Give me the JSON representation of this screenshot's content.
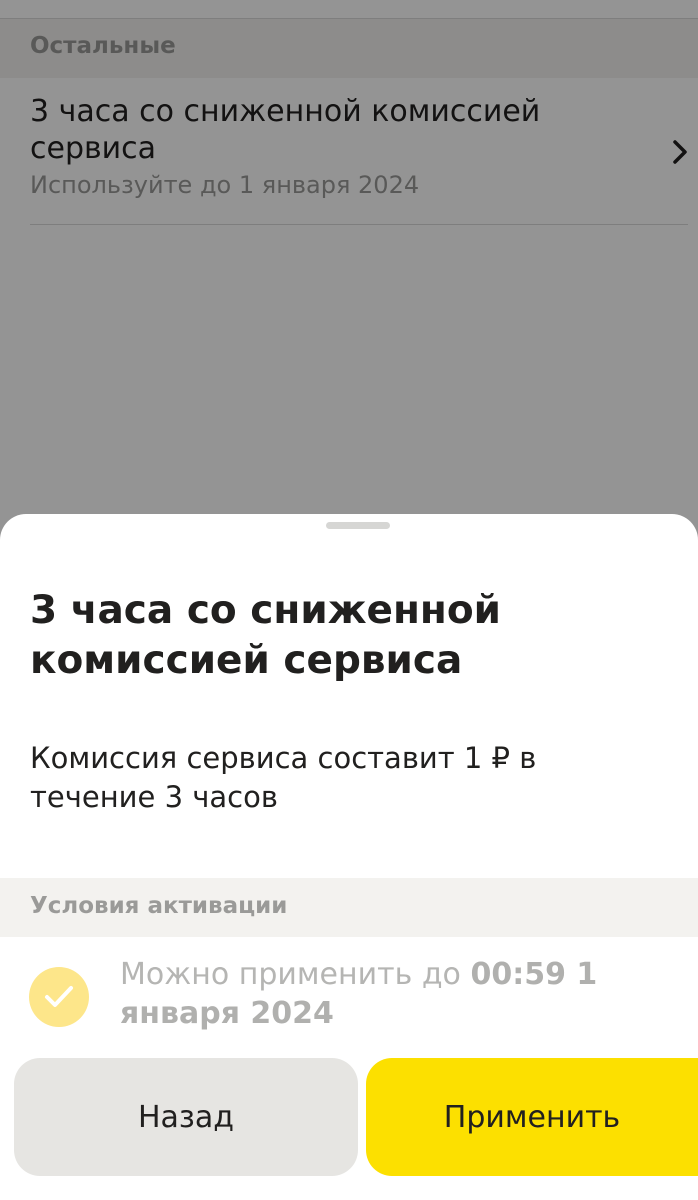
{
  "background_screen": {
    "section_title": "Остальные",
    "item": {
      "title": "3 часа со сниженной комиссией сервиса",
      "subtitle": "Используйте до 1 января 2024",
      "chevron_icon": "chevron-right-icon"
    }
  },
  "sheet": {
    "title": "3 часа со сниженной комиссией сервиса",
    "description": "Комиссия сервиса составит 1 ₽ в течение 3 часов",
    "conditions": {
      "title": "Условия активации",
      "check_icon": "check-circle-icon",
      "text_prefix": "Можно применить до ",
      "text_bold": "00:59 1 января 2024"
    },
    "buttons": {
      "back_label": "Назад",
      "apply_label": "Применить"
    }
  },
  "colors": {
    "accent": "#fce000",
    "check_circle": "#fde68a",
    "secondary_button": "#e6e5e2",
    "section_band": "#f3f2ef"
  }
}
